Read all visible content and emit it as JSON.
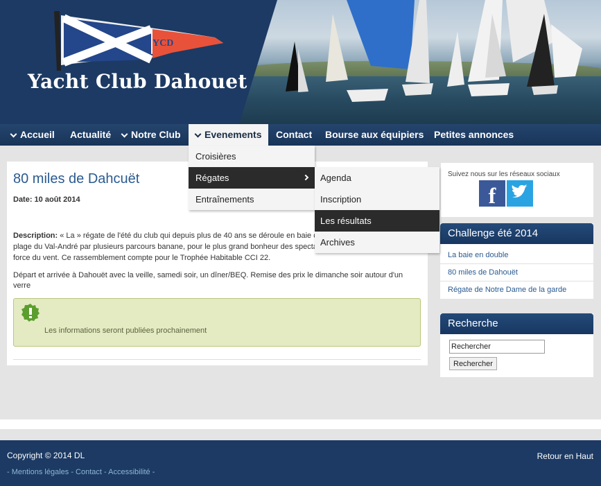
{
  "site": {
    "title": "Yacht Club Dahouet",
    "flag_text": "YCD"
  },
  "nav": {
    "items": [
      {
        "label": "Accueil",
        "has_chevron": true
      },
      {
        "label": "Actualité",
        "has_chevron": false
      },
      {
        "label": "Notre Club",
        "has_chevron": true
      },
      {
        "label": "Evenements",
        "has_chevron": true,
        "active": true
      },
      {
        "label": "Contact",
        "has_chevron": false
      },
      {
        "label": "Bourse aux équipiers",
        "has_chevron": false
      },
      {
        "label": "Petites annonces",
        "has_chevron": false
      }
    ]
  },
  "dropdown_events": {
    "items": [
      "Croisières",
      "Régates",
      "Entraînements"
    ]
  },
  "dropdown_regates": {
    "items": [
      "Agenda",
      "Inscription",
      "Les résultats",
      "Archives"
    ]
  },
  "post": {
    "title": "80 miles de Dahcuët",
    "date": "Date: 10 août 2014",
    "desc_label": "Description:",
    "desc_text": " « La » régate de l'été du club qui depuis plus de 40 ans se déroule en baie de Saint-Brieuc devant la plage du Val-André par plusieurs parcours banane, pour le plus grand bonheur des spectateurs, selon la direction et la force du vent. Ce rassemblement compte pour le Trophée Habitable CCI 22.",
    "para2": "Départ et arrivée à Dahouët avec la veille, samedi soir, un dîner/BEQ. Remise des prix le dimanche soir autour d'un verre",
    "notice": "Les informations seront publiées prochainement"
  },
  "sidebar": {
    "social_text": "Suivez nous sur les réseaux sociaux",
    "challenge": {
      "title": "Challenge été 2014",
      "links": [
        "La baie en double",
        "80 miles de Dahouët",
        "Régate de Notre Dame de la garde"
      ]
    },
    "search": {
      "title": "Recherche",
      "placeholder": "Rechercher",
      "value": "Rechercher",
      "button": "Rechercher"
    }
  },
  "footer": {
    "copyright": "Copyright © 2014 DL",
    "links": "- Mentions légales - Contact - Accessibilité -",
    "back_top": "Retour en Haut"
  },
  "colors": {
    "navy": "#1c3a63",
    "link": "#2a5a90",
    "flag_red": "#e8523a",
    "notice_bg": "#e4ebc3"
  }
}
